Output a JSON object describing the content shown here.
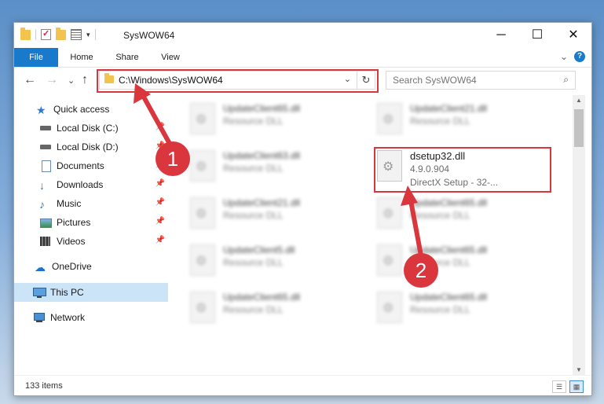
{
  "window": {
    "title": "SysWOW64",
    "min_glyph": "─",
    "max_glyph": "☐",
    "close_glyph": "✕"
  },
  "qat": {
    "dropdown_glyph": "▾"
  },
  "ribbon": {
    "tabs": [
      "File",
      "Home",
      "Share",
      "View"
    ],
    "collapse_glyph": "⌄",
    "help_glyph": "?"
  },
  "nav": {
    "back_glyph": "←",
    "forward_glyph": "→",
    "recent_glyph": "⌄",
    "up_glyph": "↑",
    "address": "C:\\Windows\\SysWOW64",
    "address_dropdown_glyph": "⌄",
    "refresh_glyph": "↻",
    "search_placeholder": "Search SysWOW64",
    "search_glyph": "⌕"
  },
  "sidebar": {
    "pin_glyph": "📌",
    "items": [
      {
        "label": "Quick access",
        "icon": "star-icon",
        "pinned": false
      },
      {
        "label": "Local Disk (C:)",
        "icon": "drive-icon",
        "pinned": true
      },
      {
        "label": "Local Disk (D:)",
        "icon": "drive-icon",
        "pinned": true
      },
      {
        "label": "Documents",
        "icon": "documents-icon",
        "pinned": true
      },
      {
        "label": "Downloads",
        "icon": "downloads-icon",
        "pinned": true
      },
      {
        "label": "Music",
        "icon": "music-icon",
        "pinned": true
      },
      {
        "label": "Pictures",
        "icon": "pictures-icon",
        "pinned": true
      },
      {
        "label": "Videos",
        "icon": "videos-icon",
        "pinned": true
      },
      {
        "label": "OneDrive",
        "icon": "cloud-icon",
        "pinned": false
      },
      {
        "label": "This PC",
        "icon": "computer-icon",
        "pinned": false,
        "selected": true
      },
      {
        "label": "Network",
        "icon": "network-icon",
        "pinned": false
      }
    ]
  },
  "files": [
    {
      "name": "UpdateClient65.dll",
      "type": "Resource DLL",
      "blurred": true
    },
    {
      "name": "UpdateClient21.dll",
      "type": "Resource DLL",
      "blurred": true
    },
    {
      "name": "UpdateClient63.dll",
      "type": "Resource DLL",
      "blurred": true
    },
    {
      "name": "dsetup32.dll",
      "version": "4.9.0.904",
      "type": "DirectX Setup - 32-...",
      "blurred": false,
      "highlighted": true
    },
    {
      "name": "UpdateClient21.dll",
      "type": "Resource DLL",
      "blurred": true
    },
    {
      "name": "UpdateClient65.dll",
      "type": "Resource DLL",
      "blurred": true
    },
    {
      "name": "UpdateClient5.dll",
      "type": "Resource DLL",
      "blurred": true
    },
    {
      "name": "UpdateClient65.dll",
      "type": "Resource DLL",
      "blurred": true
    },
    {
      "name": "UpdateClient65.dll",
      "type": "Resource DLL",
      "blurred": true
    },
    {
      "name": "UpdateClient65.dll",
      "type": "Resource DLL",
      "blurred": true
    }
  ],
  "scroll": {
    "up_glyph": "▲",
    "down_glyph": "▼"
  },
  "status": {
    "item_count": "133 items"
  },
  "view_buttons": [
    {
      "name": "details-view",
      "glyph": "☰",
      "active": false
    },
    {
      "name": "tiles-view",
      "glyph": "▦",
      "active": true
    }
  ],
  "annotations": {
    "accent_color": "#d9363e",
    "step1": "1",
    "step2": "2"
  }
}
